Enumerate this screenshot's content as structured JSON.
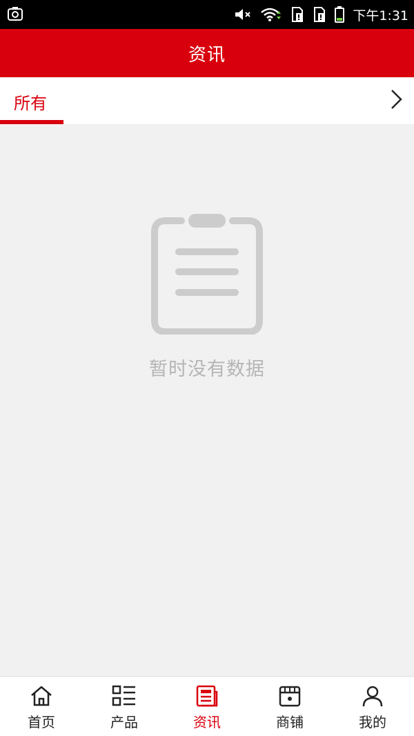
{
  "status_bar": {
    "time": "下午1:31",
    "icons": [
      "screenshot-icon",
      "mute-icon",
      "wifi-icon",
      "sim-card-icon",
      "sim-card-icon",
      "battery-icon"
    ]
  },
  "header": {
    "title": "资讯"
  },
  "tabs": [
    {
      "label": "所有",
      "active": true
    }
  ],
  "tab_more_icon": "chevron-right-icon",
  "empty_state": {
    "icon": "clipboard-icon",
    "message": "暂时没有数据"
  },
  "bottom_nav": {
    "items": [
      {
        "label": "首页",
        "icon": "home-icon",
        "active": false
      },
      {
        "label": "产品",
        "icon": "list-grid-icon",
        "active": false
      },
      {
        "label": "资讯",
        "icon": "news-icon",
        "active": true
      },
      {
        "label": "商铺",
        "icon": "shop-icon",
        "active": false
      },
      {
        "label": "我的",
        "icon": "user-icon",
        "active": false
      }
    ]
  },
  "colors": {
    "primary": "#d9000d",
    "background": "#f1f1f1",
    "empty_icon": "#cccccc",
    "empty_text": "#b5b5b5",
    "nav_text": "#222222"
  }
}
